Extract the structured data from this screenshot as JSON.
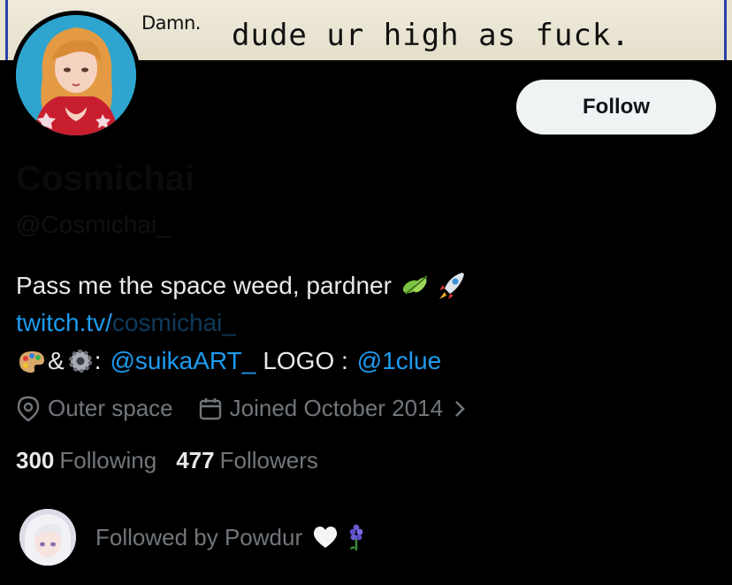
{
  "banner": {
    "small_text": "Damn.",
    "big_text": "dude ur high as fuck."
  },
  "profile": {
    "display_name": "Cosmichai",
    "handle": "@Cosmichai_",
    "follow_label": "Follow",
    "bio_text": "Pass me the space weed, pardner",
    "link_visible": "twitch.tv/",
    "link_dim": "cosmichai_",
    "credits_amp": "&",
    "credits_colon": ":",
    "credits_artist": "@suikaART_",
    "credits_logo_label": "LOGO :",
    "credits_logo_user": "@1clue",
    "location": "Outer space",
    "joined": "Joined October 2014"
  },
  "stats": {
    "following_count": "300",
    "following_label": "Following",
    "followers_count": "477",
    "followers_label": "Followers"
  },
  "followed_by": {
    "text": "Followed by Powdur"
  },
  "icons": {
    "herb": "herb-icon",
    "rocket": "rocket-icon",
    "palette": "palette-icon",
    "gear": "gear-icon",
    "location": "location-pin-icon",
    "calendar": "calendar-icon",
    "chevron": "chevron-right-icon",
    "heart": "white-heart-icon",
    "flower": "hyacinth-icon"
  },
  "colors": {
    "link": "#1d9bf0",
    "secondary": "#71767b",
    "background": "#000000"
  }
}
